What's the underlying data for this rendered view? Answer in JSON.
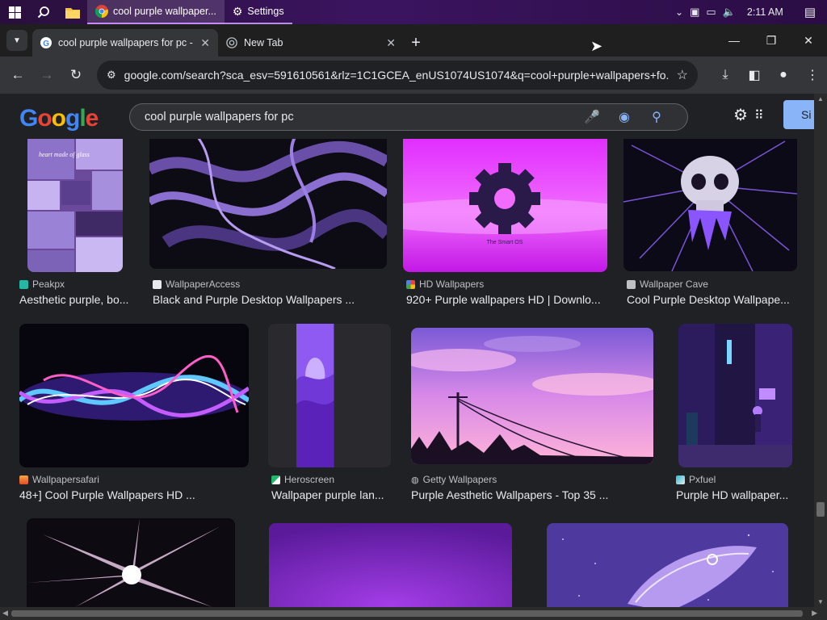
{
  "taskbar": {
    "tasks": [
      {
        "label": "cool purple wallpaper..."
      },
      {
        "label": "Settings"
      }
    ],
    "clock": "2:11 AM"
  },
  "browser": {
    "tabs": [
      {
        "label": "cool purple wallpapers for pc - "
      },
      {
        "label": "New Tab"
      }
    ],
    "url": "google.com/search?sca_esv=591610561&rlz=1C1GCEA_enUS1074US1074&q=cool+purple+wallpapers+fo..."
  },
  "google": {
    "logo": "Google",
    "query": "cool purple wallpapers for pc",
    "signin_label": "Si"
  },
  "results": [
    {
      "source": "Peakpx",
      "title": "Aesthetic purple, bo..."
    },
    {
      "source": "WallpaperAccess",
      "title": "Black and Purple Desktop Wallpapers ..."
    },
    {
      "source": "HD Wallpapers",
      "title": "920+ Purple wallpapers HD | Downlo..."
    },
    {
      "source": "Wallpaper Cave",
      "title": "Cool Purple Desktop Wallpape..."
    },
    {
      "source": "Wallpapersafari",
      "title": "48+] Cool Purple Wallpapers HD ..."
    },
    {
      "source": "Heroscreen",
      "title": "Wallpaper purple lan..."
    },
    {
      "source": "Getty Wallpapers",
      "title": "Purple Aesthetic Wallpapers - Top 35 ..."
    },
    {
      "source": "Pxfuel",
      "title": "Purple HD wallpaper..."
    }
  ],
  "image_text": {
    "collage_caption": "heart made of glass",
    "gear_caption": "The Smart OS"
  },
  "colors": {
    "accent": "#8ab4f8",
    "page_bg": "#202124",
    "taskbar": "#3b1460"
  }
}
